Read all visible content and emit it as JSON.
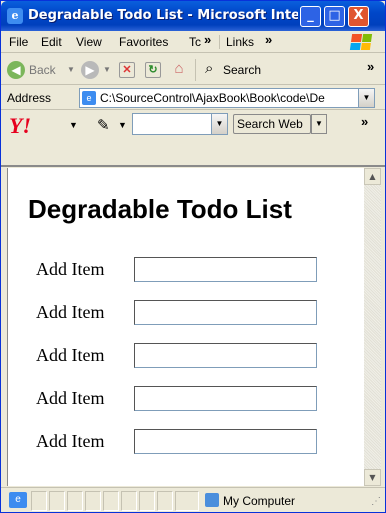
{
  "window": {
    "title": "Degradable Todo List - Microsoft Inte...",
    "buttons": {
      "minimize": "_",
      "maximize": "□",
      "close": "X"
    }
  },
  "menubar": {
    "items": [
      {
        "label": "File"
      },
      {
        "label": "Edit"
      },
      {
        "label": "View"
      },
      {
        "label": "Favorites"
      },
      {
        "label": "Tc"
      }
    ],
    "chevron": "»",
    "links": "Links",
    "links_chevron": "»"
  },
  "toolbar": {
    "back_label": "Back",
    "search_label": "Search",
    "chevron": "»"
  },
  "addressbar": {
    "label": "Address",
    "value": "C:\\SourceControl\\AjaxBook\\Book\\code\\De"
  },
  "yahoobar": {
    "logo": "Y!",
    "search_web_label": "Search Web",
    "chevron": "»"
  },
  "page": {
    "title": "Degradable Todo List",
    "rows": [
      {
        "label": "Add Item",
        "value": ""
      },
      {
        "label": "Add Item",
        "value": ""
      },
      {
        "label": "Add Item",
        "value": ""
      },
      {
        "label": "Add Item",
        "value": ""
      },
      {
        "label": "Add Item",
        "value": ""
      }
    ]
  },
  "statusbar": {
    "zone": "My Computer"
  },
  "colors": {
    "titlebar": "#0046c8",
    "close_button": "#e0552f",
    "yahoo_red": "#e6001e"
  }
}
